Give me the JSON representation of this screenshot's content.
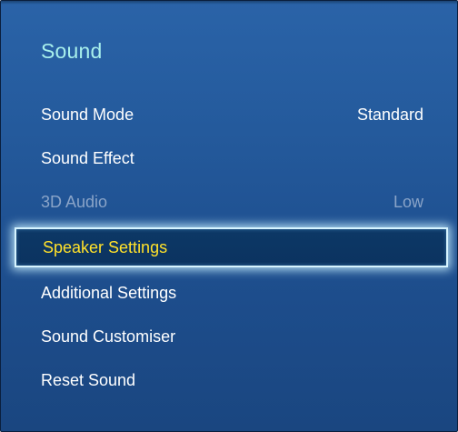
{
  "menu": {
    "title": "Sound",
    "items": [
      {
        "label": "Sound Mode",
        "value": "Standard",
        "state": "normal"
      },
      {
        "label": "Sound Effect",
        "value": "",
        "state": "normal"
      },
      {
        "label": "3D Audio",
        "value": "Low",
        "state": "disabled"
      },
      {
        "label": "Speaker Settings",
        "value": "",
        "state": "selected"
      },
      {
        "label": "Additional Settings",
        "value": "",
        "state": "normal"
      },
      {
        "label": "Sound Customiser",
        "value": "",
        "state": "normal"
      },
      {
        "label": "Reset Sound",
        "value": "",
        "state": "normal"
      }
    ]
  },
  "colors": {
    "panel_background": "#245a9c",
    "title_color": "#a8f0ec",
    "selected_text": "#ffe12a",
    "disabled_text": "#8aa4c8",
    "selected_border": "#d6f4ff"
  }
}
